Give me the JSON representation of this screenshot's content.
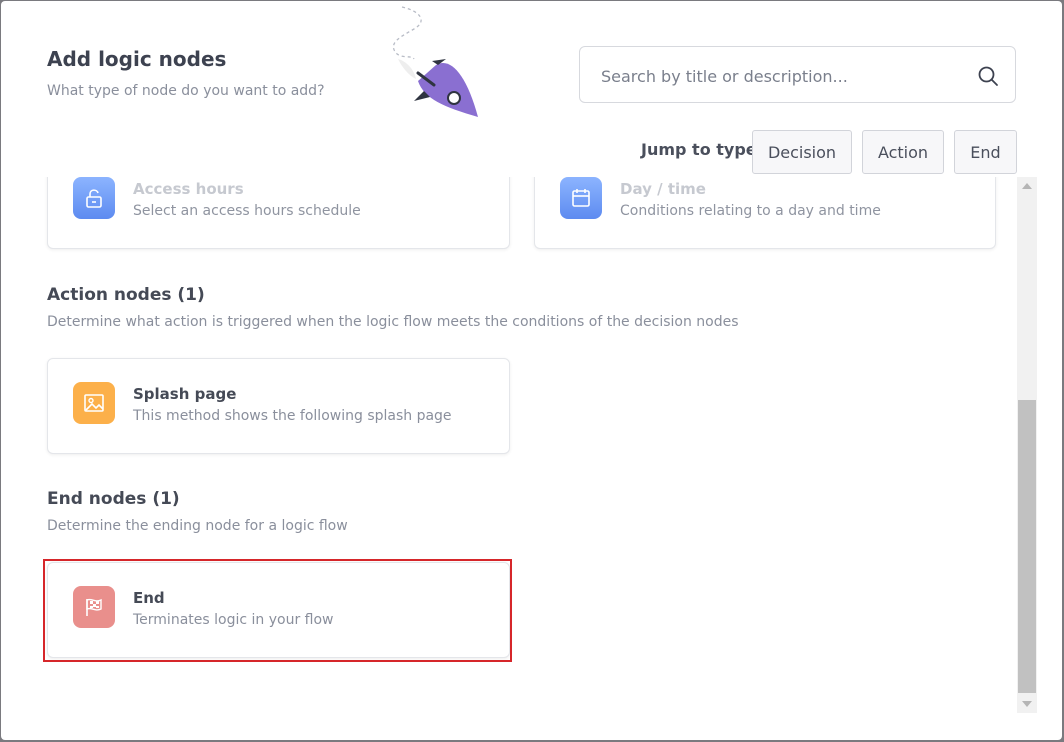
{
  "header": {
    "title": "Add logic nodes",
    "subtitle": "What type of node do you want to add?"
  },
  "search": {
    "placeholder": "Search by title or description...",
    "value": "",
    "icon": "search-icon"
  },
  "jump": {
    "label": "Jump to type",
    "buttons": [
      "Decision",
      "Action",
      "End"
    ]
  },
  "decision_nodes": [
    {
      "title": "Access hours",
      "description": "Select an access hours schedule",
      "icon": "unlocked-padlock-icon",
      "color": "#6f9bf7"
    },
    {
      "title": "Day / time",
      "description": "Conditions relating to a day and time",
      "icon": "calendar-icon",
      "color": "#6f9bf7"
    }
  ],
  "action_section": {
    "title": "Action nodes (1)",
    "description": "Determine what action is triggered when the logic flow meets the conditions of the decision nodes",
    "nodes": [
      {
        "title": "Splash page",
        "description": "This method shows the following splash page",
        "icon": "image-icon",
        "color": "#fcb04a"
      }
    ]
  },
  "end_section": {
    "title": "End nodes (1)",
    "description": "Determine the ending node for a logic flow",
    "nodes": [
      {
        "title": "End",
        "description": "Terminates logic in your flow",
        "icon": "checkered-flag-icon",
        "color": "#e98f8c"
      }
    ]
  },
  "colors": {
    "highlight": "#d6262a",
    "rocket": "#8a6fd1"
  },
  "decoration": "rocket-icon"
}
